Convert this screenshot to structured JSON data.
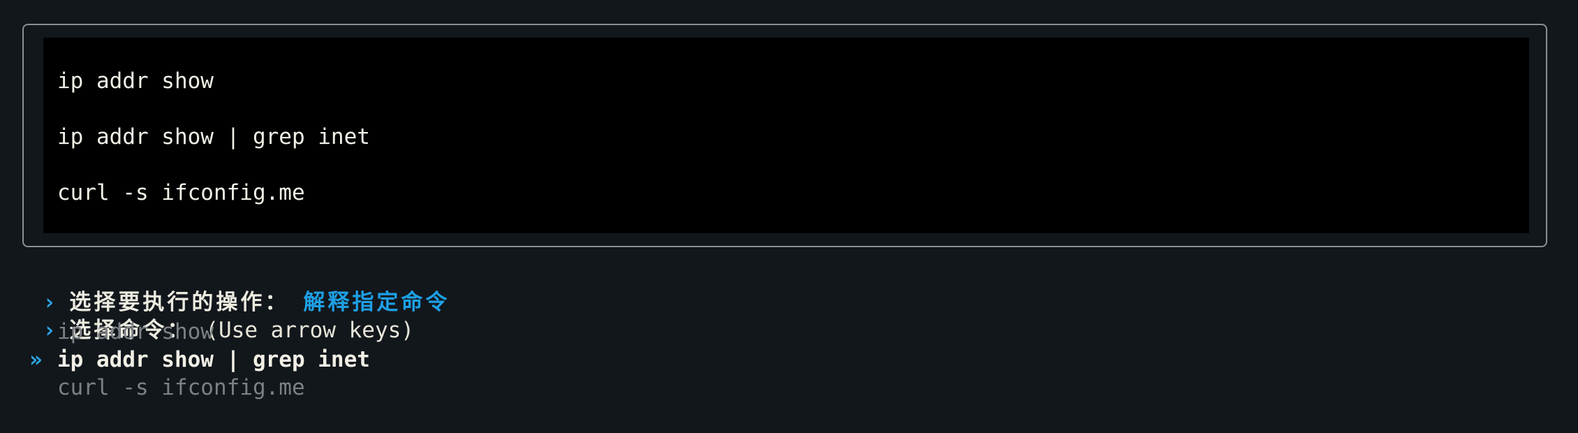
{
  "code_block": {
    "lines": [
      "ip addr show",
      "ip addr show | grep inet",
      "curl -s ifconfig.me"
    ]
  },
  "prompts": [
    {
      "marker": "›",
      "label": "选择要执行的操作：",
      "answer": "解释指定命令"
    },
    {
      "marker": "›",
      "label": "选择命令：",
      "hint": "(Use arrow keys)"
    }
  ],
  "options": {
    "pointer": "»",
    "items": [
      "ip addr show",
      "ip addr show | grep inet",
      "curl -s ifconfig.me"
    ],
    "selected_index": 1
  },
  "colors": {
    "background": "#12171c",
    "code_background": "#000000",
    "accent": "#1ea0e6",
    "text": "#e8e6da",
    "dim_text": "#7d8084"
  }
}
